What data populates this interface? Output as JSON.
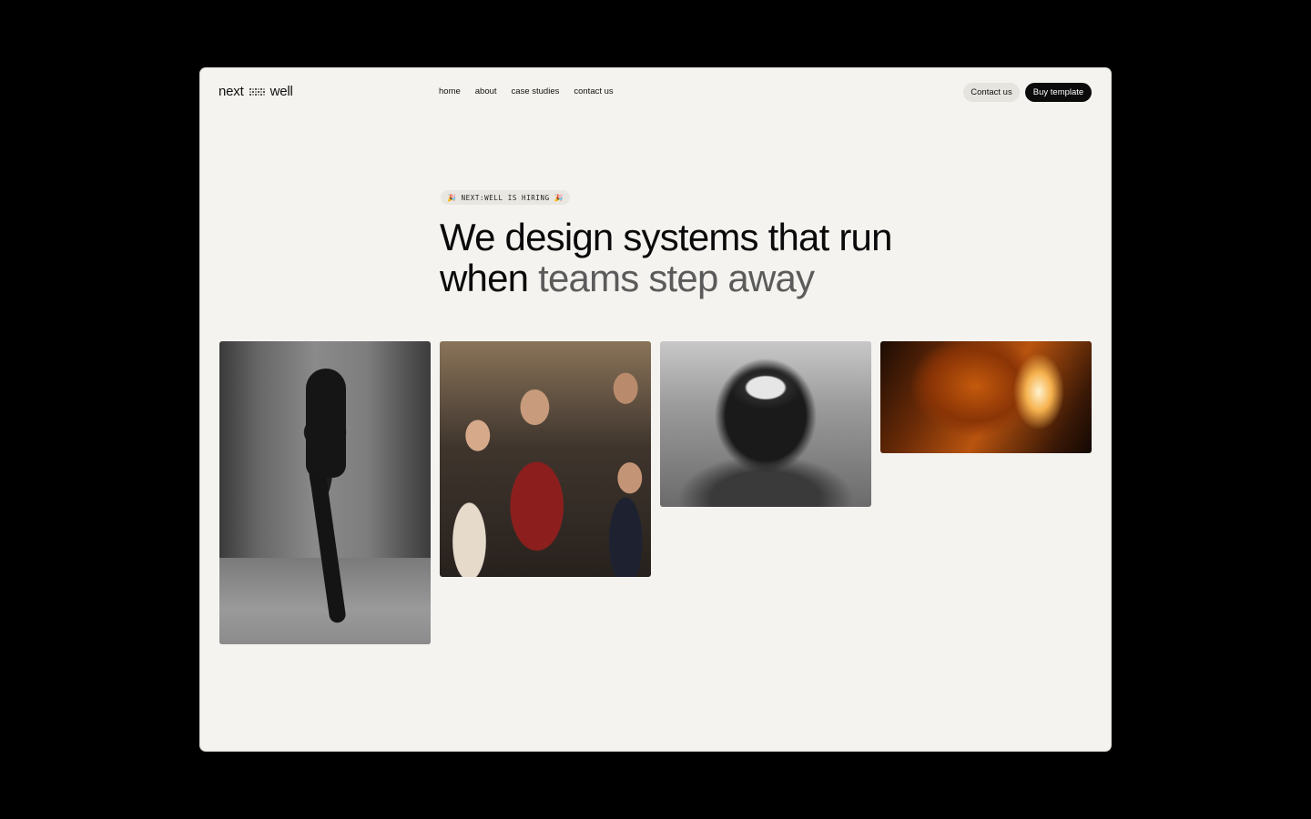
{
  "header": {
    "logo_left": "next",
    "logo_right": "well",
    "nav": [
      {
        "label": "home"
      },
      {
        "label": "about"
      },
      {
        "label": "case studies"
      },
      {
        "label": "contact us"
      }
    ],
    "contact_button": "Contact us",
    "buy_button": "Buy template"
  },
  "hero": {
    "badge": "NEXT:WELL IS HIRING",
    "badge_emoji": "🎉",
    "headline_line1": "We design systems that run",
    "headline_line2_dark": "when",
    "headline_line2_muted": "teams step away"
  },
  "gallery": [
    {
      "alt": "runner-photo"
    },
    {
      "alt": "team-meeting-photo"
    },
    {
      "alt": "motocross-rider-photo"
    },
    {
      "alt": "abstract-flame-photo"
    }
  ],
  "colors": {
    "page_background": "#000000",
    "frame_background": "#f4f3ef",
    "primary_button": "#0b0b0b",
    "secondary_button": "#e5e4df",
    "muted_text": "#5b5b5b"
  }
}
